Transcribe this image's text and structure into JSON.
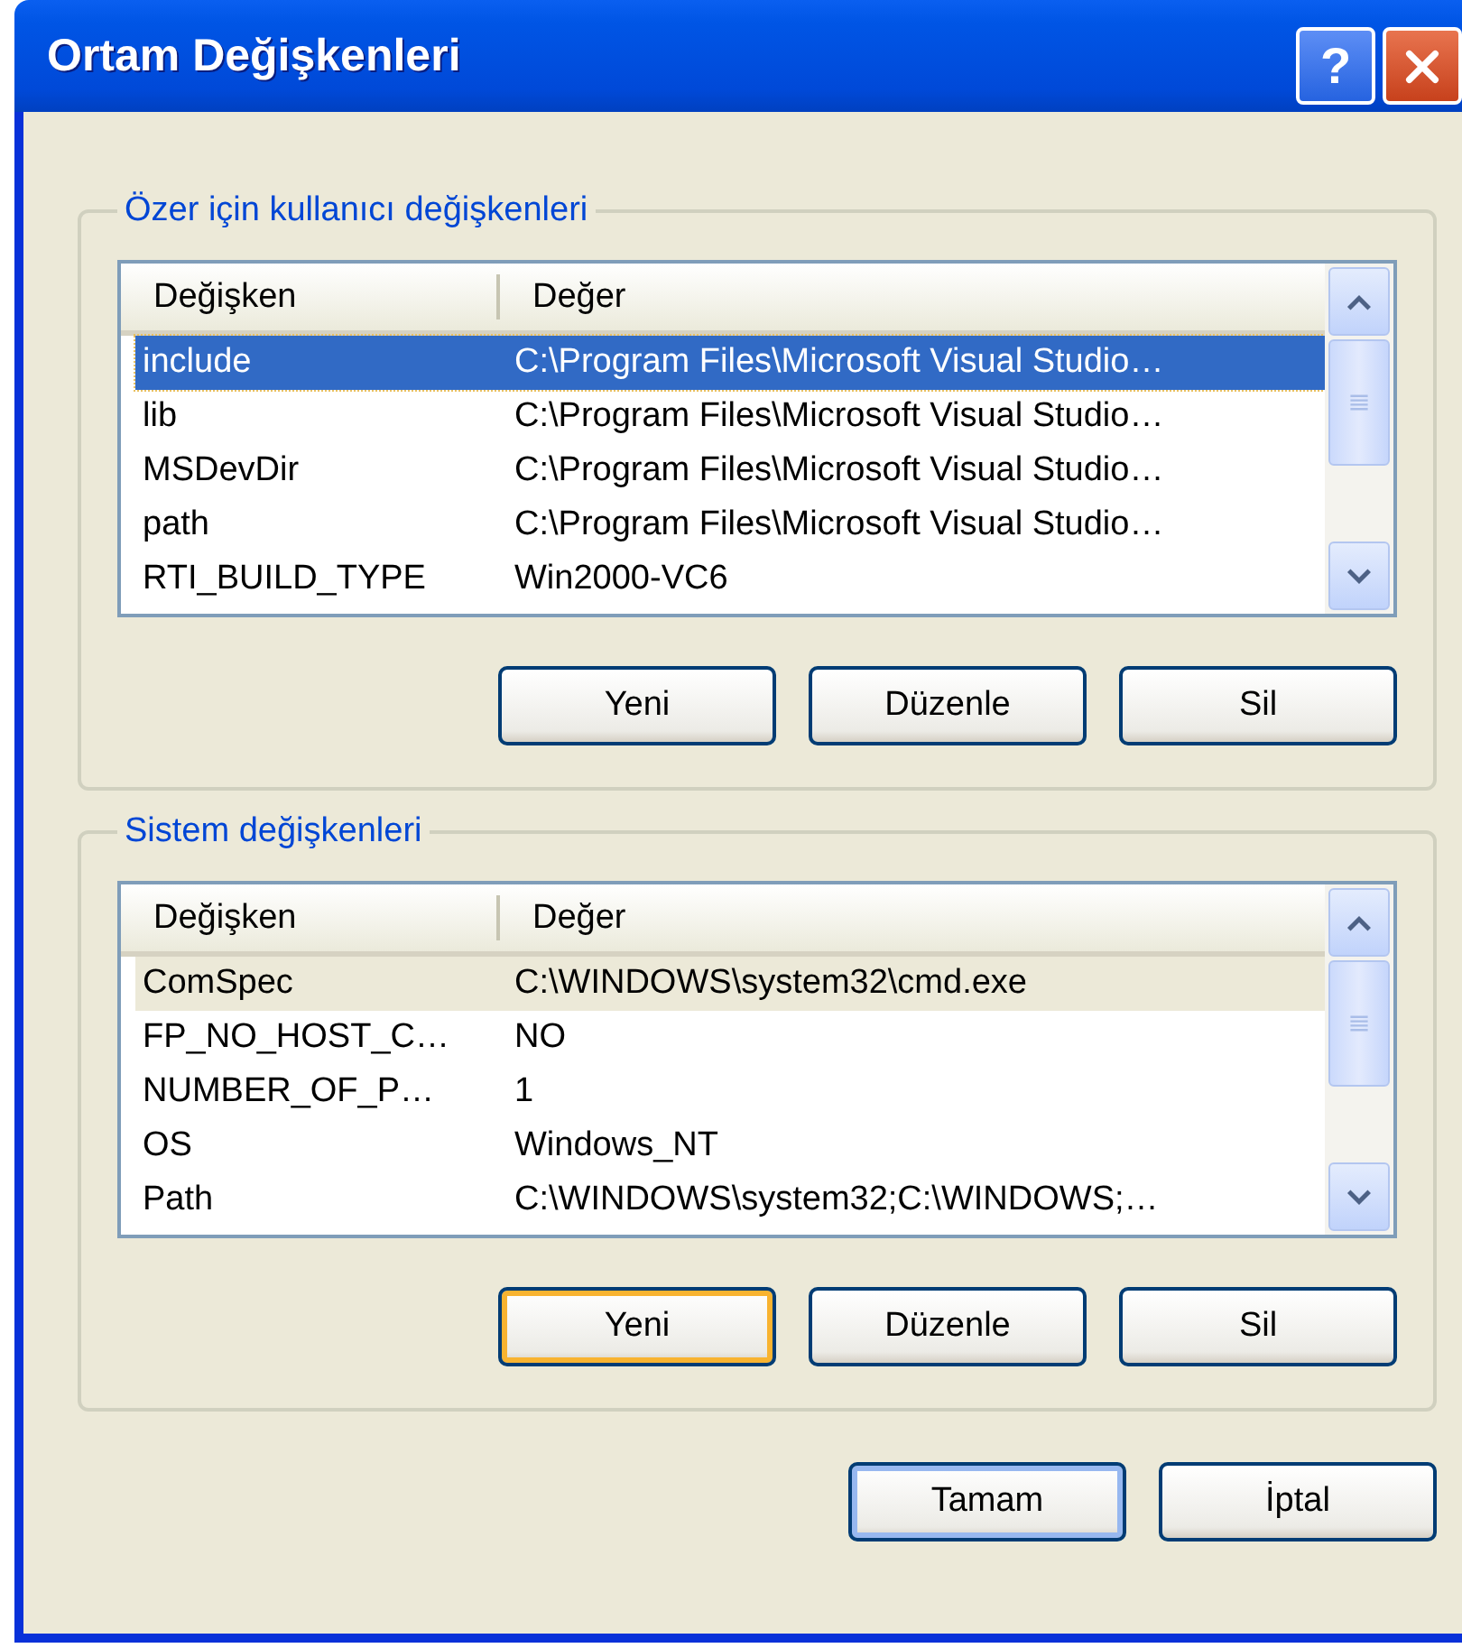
{
  "window": {
    "title": "Ortam Değişkenleri",
    "title_buttons": [
      {
        "kind": "help",
        "label": "?"
      },
      {
        "kind": "close"
      }
    ]
  },
  "groups": [
    {
      "title": "Özer için kullanıcı değişkenleri",
      "focused": true,
      "columns": [
        "Değişken",
        "Değer"
      ],
      "rows": [
        {
          "name": "include",
          "value": "C:\\Program Files\\Microsoft Visual Studio…",
          "selected": true
        },
        {
          "name": "lib",
          "value": "C:\\Program Files\\Microsoft Visual Studio…",
          "selected": false
        },
        {
          "name": "MSDevDir",
          "value": "C:\\Program Files\\Microsoft Visual Studio…",
          "selected": false
        },
        {
          "name": "path",
          "value": "C:\\Program Files\\Microsoft Visual Studio…",
          "selected": false
        },
        {
          "name": "RTI_BUILD_TYPE",
          "value": "Win2000-VC6",
          "selected": false
        }
      ],
      "buttons": [
        {
          "label": "Yeni",
          "focused": false
        },
        {
          "label": "Düzenle",
          "focused": false
        },
        {
          "label": "Sil",
          "focused": false
        }
      ]
    },
    {
      "title": "Sistem değişkenleri",
      "focused": false,
      "columns": [
        "Değişken",
        "Değer"
      ],
      "rows": [
        {
          "name": "ComSpec",
          "value": "C:\\WINDOWS\\system32\\cmd.exe",
          "selected": true
        },
        {
          "name": "FP_NO_HOST_C…",
          "value": "NO",
          "selected": false
        },
        {
          "name": "NUMBER_OF_P…",
          "value": "1",
          "selected": false
        },
        {
          "name": "OS",
          "value": "Windows_NT",
          "selected": false
        },
        {
          "name": "Path",
          "value": "C:\\WINDOWS\\system32;C:\\WINDOWS;…",
          "selected": false
        }
      ],
      "buttons": [
        {
          "label": "Yeni",
          "focused": true
        },
        {
          "label": "Düzenle",
          "focused": false
        },
        {
          "label": "Sil",
          "focused": false
        }
      ]
    }
  ],
  "footer_buttons": [
    {
      "label": "Tamam",
      "default": true
    },
    {
      "label": "İptal",
      "default": false
    }
  ]
}
